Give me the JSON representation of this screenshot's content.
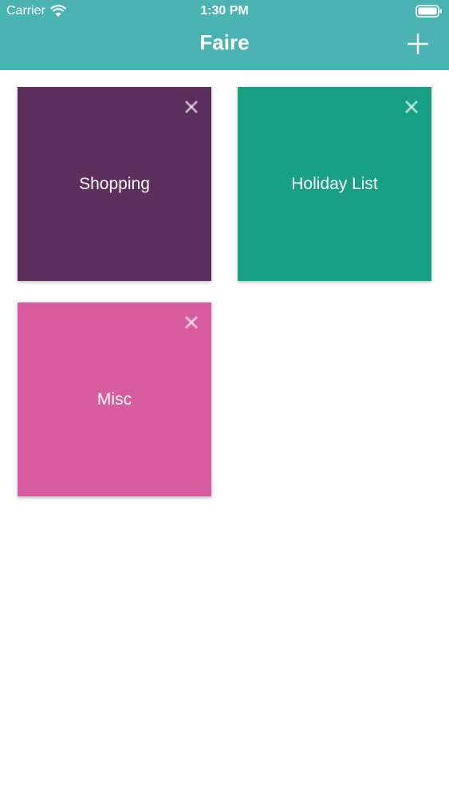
{
  "status_bar": {
    "carrier": "Carrier",
    "time": "1:30 PM",
    "wifi_icon": "wifi-icon",
    "battery_icon": "battery-icon"
  },
  "nav": {
    "title": "Faire",
    "add_icon": "plus-icon",
    "background": "#4bb4b3"
  },
  "lists": [
    {
      "title": "Shopping",
      "color": "#5e2f5c",
      "close_icon": "close-icon"
    },
    {
      "title": "Holiday List",
      "color": "#18a085",
      "close_icon": "close-icon"
    },
    {
      "title": "Misc",
      "color": "#d75ca0",
      "close_icon": "close-icon"
    }
  ]
}
